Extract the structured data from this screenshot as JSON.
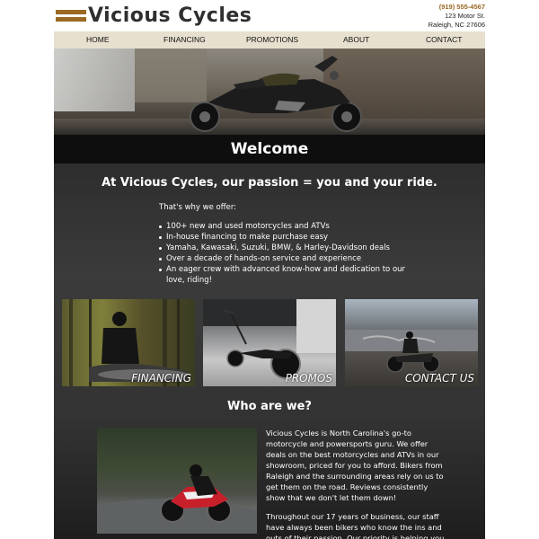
{
  "brand": {
    "name": "Vicious Cycles",
    "phone": "(919) 555-4567",
    "address_line1": "123 Motor St.",
    "address_line2": "Raleigh, NC 27606",
    "accent_color": "#9a6a22"
  },
  "nav": {
    "items": [
      {
        "label": "HOME"
      },
      {
        "label": "FINANCING"
      },
      {
        "label": "PROMOTIONS"
      },
      {
        "label": "ABOUT"
      },
      {
        "label": "CONTACT"
      }
    ]
  },
  "welcome": {
    "title": "Welcome",
    "headline": "At Vicious Cycles, our passion = you and your ride.",
    "offer_intro": "That's why we offer:",
    "offers": [
      "100+ new and used motorcycles and ATVs",
      "In-house financing to make purchase easy",
      "Yamaha, Kawasaki, Suzuki, BMW, & Harley-Davidson deals",
      "Over a decade of hands-on service and experience",
      "An eager crew with advanced know-how and dedication to our love, riding!"
    ]
  },
  "tiles": [
    {
      "label": "FINANCING"
    },
    {
      "label": "PROMOS"
    },
    {
      "label": "CONTACT US"
    }
  ],
  "who": {
    "title": "Who are we?",
    "paragraph1": "Vicious Cycles is North Carolina's go-to motorcycle and powersports guru. We offer deals on the best motorcycles and ATVs in our showroom, priced for you to afford. Bikers from Raleigh and the surrounding areas rely on us to get them on the road. Reviews consistently show that we don't let them down!",
    "paragraph2": "Throughout our 17 years of business, our staff have always been bikers who know the ins and outs of their passion. Our priority is helping you"
  }
}
